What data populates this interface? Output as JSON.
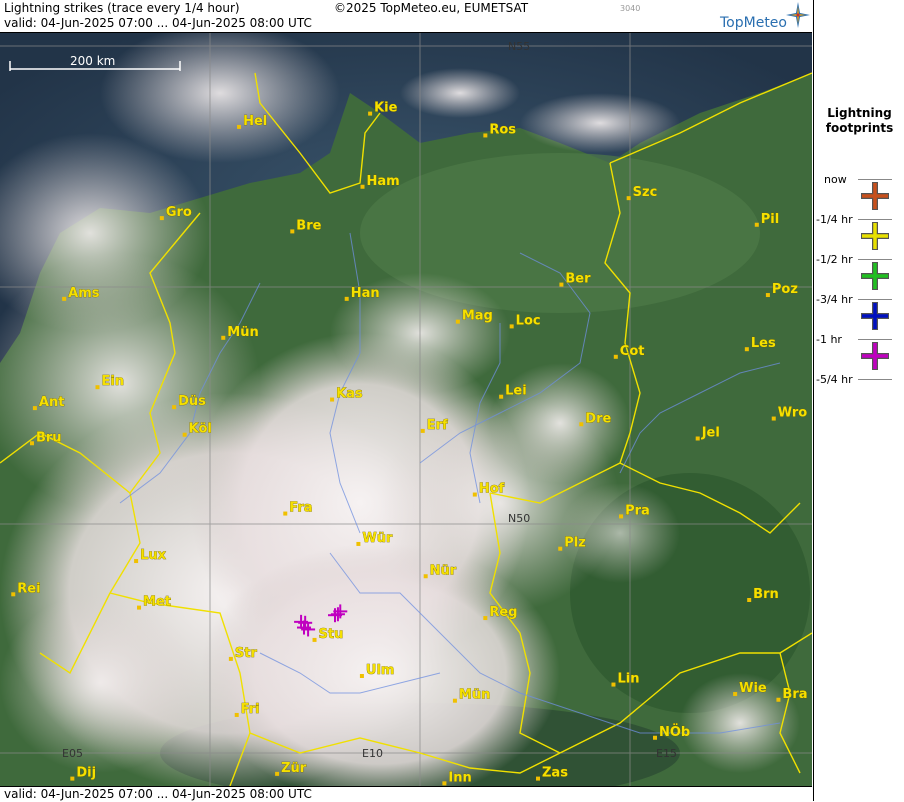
{
  "header": {
    "title": "Lightning strikes (trace every 1/4 hour)",
    "valid": "valid:  04-Jun-2025 07:00 ... 04-Jun-2025 08:00 UTC",
    "copyright": "©2025 TopMeteo.eu, EUMETSAT",
    "code": "3040",
    "logo": "TopMeteo"
  },
  "footer": {
    "valid": "valid:  04-Jun-2025 07:00 ... 04-Jun-2025 08:00 UTC"
  },
  "scale": {
    "label": "200 km"
  },
  "grid_labels": {
    "n55": "N55",
    "n50": "N50",
    "e05": "E05",
    "e10": "E10",
    "e15": "E15"
  },
  "legend": {
    "title_line1": "Lightning",
    "title_line2": "footprints",
    "items": [
      {
        "label": "now",
        "color": "#c8501c"
      },
      {
        "label": "-1/4 hr",
        "color": "#e8e000"
      },
      {
        "label": "-1/2 hr",
        "color": "#20c020"
      },
      {
        "label": "-3/4 hr",
        "color": "#0010c0"
      },
      {
        "label": "-1 hr",
        "color": "#c000c0"
      },
      {
        "label": "-5/4 hr",
        "color": ""
      }
    ]
  },
  "cities": [
    {
      "name": "Kie",
      "lon": 10.13,
      "lat": 54.32
    },
    {
      "name": "Hel",
      "lon": 7.89,
      "lat": 54.18
    },
    {
      "name": "Ros",
      "lon": 12.1,
      "lat": 54.09
    },
    {
      "name": "Ham",
      "lon": 10.0,
      "lat": 53.55
    },
    {
      "name": "Szc",
      "lon": 14.55,
      "lat": 53.43
    },
    {
      "name": "Gro",
      "lon": 6.57,
      "lat": 53.22
    },
    {
      "name": "Bre",
      "lon": 8.8,
      "lat": 53.08
    },
    {
      "name": "Pil",
      "lon": 16.74,
      "lat": 53.15
    },
    {
      "name": "Ber",
      "lon": 13.4,
      "lat": 52.52
    },
    {
      "name": "Ams",
      "lon": 4.9,
      "lat": 52.37
    },
    {
      "name": "Han",
      "lon": 9.73,
      "lat": 52.37
    },
    {
      "name": "Poz",
      "lon": 16.93,
      "lat": 52.41
    },
    {
      "name": "Mag",
      "lon": 11.63,
      "lat": 52.13
    },
    {
      "name": "Loc",
      "lon": 12.55,
      "lat": 52.08
    },
    {
      "name": "Mün",
      "lon": 7.62,
      "lat": 51.96
    },
    {
      "name": "Cot",
      "lon": 14.33,
      "lat": 51.76
    },
    {
      "name": "Les",
      "lon": 16.57,
      "lat": 51.84
    },
    {
      "name": "Ein",
      "lon": 5.47,
      "lat": 51.44
    },
    {
      "name": "Kas",
      "lon": 9.48,
      "lat": 51.31
    },
    {
      "name": "Lei",
      "lon": 12.37,
      "lat": 51.34
    },
    {
      "name": "Ant",
      "lon": 4.4,
      "lat": 51.22
    },
    {
      "name": "Düs",
      "lon": 6.78,
      "lat": 51.23
    },
    {
      "name": "Dre",
      "lon": 13.74,
      "lat": 51.05
    },
    {
      "name": "Wro",
      "lon": 17.03,
      "lat": 51.11
    },
    {
      "name": "Erf",
      "lon": 11.03,
      "lat": 50.98
    },
    {
      "name": "Bru",
      "lon": 4.35,
      "lat": 50.85
    },
    {
      "name": "Köl",
      "lon": 6.96,
      "lat": 50.94
    },
    {
      "name": "Jel",
      "lon": 15.73,
      "lat": 50.9
    },
    {
      "name": "Hof",
      "lon": 11.92,
      "lat": 50.31
    },
    {
      "name": "Fra",
      "lon": 8.68,
      "lat": 50.11
    },
    {
      "name": "Pra",
      "lon": 14.42,
      "lat": 50.08
    },
    {
      "name": "Wür",
      "lon": 9.93,
      "lat": 49.79
    },
    {
      "name": "Plz",
      "lon": 13.38,
      "lat": 49.74
    },
    {
      "name": "Lux",
      "lon": 6.13,
      "lat": 49.61
    },
    {
      "name": "Nür",
      "lon": 11.08,
      "lat": 49.45
    },
    {
      "name": "Rei",
      "lon": 4.03,
      "lat": 49.26
    },
    {
      "name": "Met",
      "lon": 6.18,
      "lat": 49.12
    },
    {
      "name": "Brn",
      "lon": 16.61,
      "lat": 49.2
    },
    {
      "name": "Reg",
      "lon": 12.1,
      "lat": 49.01
    },
    {
      "name": "Stu",
      "lon": 9.18,
      "lat": 48.78
    },
    {
      "name": "Str",
      "lon": 7.75,
      "lat": 48.58
    },
    {
      "name": "Ulm",
      "lon": 9.99,
      "lat": 48.4
    },
    {
      "name": "Lin",
      "lon": 14.29,
      "lat": 48.31
    },
    {
      "name": "Wie",
      "lon": 16.37,
      "lat": 48.21
    },
    {
      "name": "Bra",
      "lon": 17.11,
      "lat": 48.15
    },
    {
      "name": "Mün",
      "lon": 11.58,
      "lat": 48.14
    },
    {
      "name": "Fri",
      "lon": 7.85,
      "lat": 47.99
    },
    {
      "name": "NÖb",
      "lon": 15.0,
      "lat": 47.75
    },
    {
      "name": "Zür",
      "lon": 8.54,
      "lat": 47.37
    },
    {
      "name": "Dij",
      "lon": 5.04,
      "lat": 47.32
    },
    {
      "name": "Inn",
      "lon": 11.4,
      "lat": 47.27
    },
    {
      "name": "Zas",
      "lon": 13.0,
      "lat": 47.32
    }
  ],
  "strikes": [
    {
      "lon": 8.95,
      "lat": 48.97,
      "age": "-1 hr"
    },
    {
      "lon": 9.02,
      "lat": 48.96,
      "age": "-1 hr"
    },
    {
      "lon": 9.0,
      "lat": 48.91,
      "age": "-1 hr"
    },
    {
      "lon": 9.07,
      "lat": 48.89,
      "age": "-1 hr"
    },
    {
      "lon": 9.58,
      "lat": 49.05,
      "age": "-1 hr"
    },
    {
      "lon": 9.62,
      "lat": 49.08,
      "age": "-1 hr"
    },
    {
      "lon": 9.53,
      "lat": 49.04,
      "age": "-1 hr"
    }
  ]
}
